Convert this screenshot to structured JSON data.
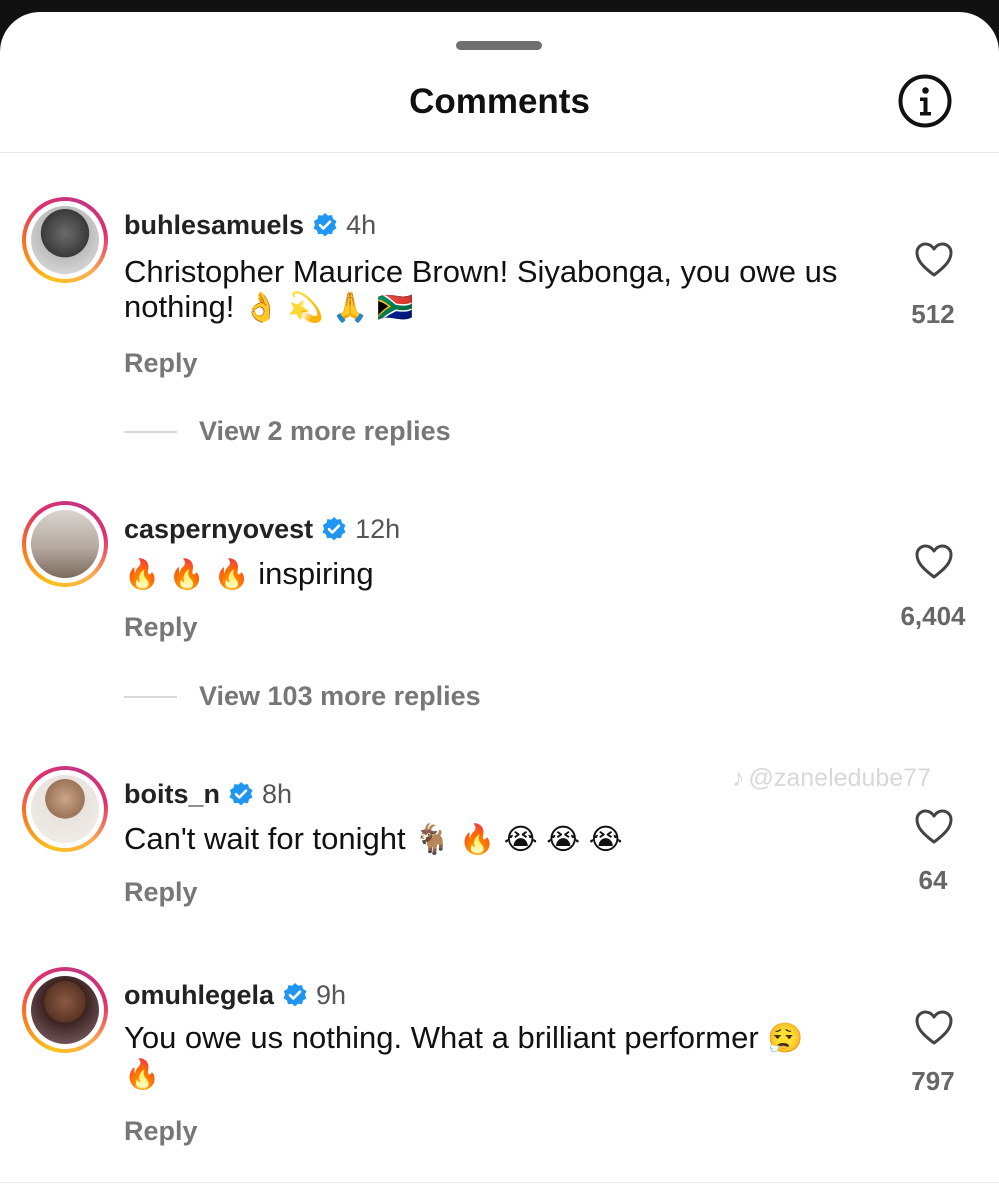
{
  "header": {
    "title": "Comments",
    "info_icon": "info-icon"
  },
  "colors": {
    "accent_verified": "#1f96f2",
    "text_muted": "#777777"
  },
  "comments": [
    {
      "username": "buhlesamuels",
      "time": "4h",
      "text": "Christopher Maurice Brown! Siyabonga, you owe us nothing!",
      "emoji": [
        "👌",
        "💫",
        "🙏",
        "🇿🇦"
      ],
      "likes": "512",
      "reply_label": "Reply",
      "view_replies": "View 2 more replies"
    },
    {
      "username": "caspernyovest",
      "time": "12h",
      "emoji_prefix": [
        "🔥",
        "🔥",
        "🔥"
      ],
      "text": "inspiring",
      "likes": "6,404",
      "reply_label": "Reply",
      "view_replies": "View 103 more replies"
    },
    {
      "username": "boits_n",
      "time": "8h",
      "text": "Can't wait for tonight",
      "emoji": [
        "🐐",
        "🔥",
        "😭",
        "😭",
        "😭"
      ],
      "likes": "64",
      "reply_label": "Reply"
    },
    {
      "username": "omuhlegela",
      "time": "9h",
      "text": "You owe us nothing. What a brilliant performer",
      "emoji": [
        "😮‍💨",
        "🔥"
      ],
      "likes": "797",
      "reply_label": "Reply"
    }
  ],
  "watermark": {
    "handle": "@zaneledube77"
  }
}
